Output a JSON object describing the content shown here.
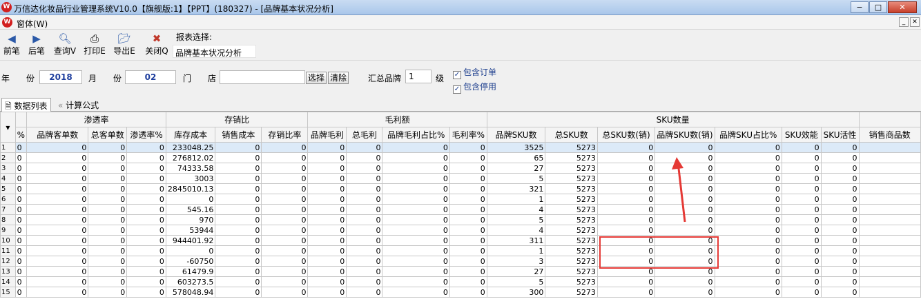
{
  "window": {
    "title": "万信达化妆品行业管理系统V10.0【旗舰版:1】【PPT】(180327) - [品牌基本状况分析]",
    "logo_text": "W"
  },
  "menu": {
    "item": "窗体(W)"
  },
  "toolbar": {
    "prev": "前笔",
    "next": "后笔",
    "query": "查询V",
    "print": "打印E",
    "export": "导出E",
    "close": "关闭Q",
    "report_select_label": "报表选择:",
    "report_value": "品牌基本状况分析"
  },
  "filter": {
    "year_label": "年　　份",
    "year_value": "2018",
    "month_label": "月　　份",
    "month_value": "02",
    "store_label": "门　　店",
    "store_value": "",
    "select_btn": "选择",
    "clear_btn": "清除",
    "brand_level_label": "汇总品牌",
    "brand_level_value": "1",
    "level_suffix": "级",
    "include_orders": "包含订单",
    "include_disabled": "包含停用"
  },
  "tabs": {
    "data_list": "数据列表",
    "formula": "计算公式"
  },
  "grid": {
    "groups": {
      "penetration": "渗透率",
      "stock_sales": "存销比",
      "gross_profit": "毛利额",
      "sku": "SKU数量"
    },
    "columns": [
      "%",
      "品牌客单数",
      "总客单数",
      "渗透率%",
      "库存成本",
      "销售成本",
      "存销比率",
      "品牌毛利",
      "总毛利",
      "品牌毛利占比%",
      "毛利率%",
      "品牌SKU数",
      "总SKU数",
      "总SKU数(销)",
      "品牌SKU数(销)",
      "品牌SKU占比%",
      "SKU效能",
      "SKU活性",
      "销售商品数"
    ],
    "rows": [
      {
        "n": "1",
        "stock": "233048.25",
        "sku": "3525",
        "total": "5273"
      },
      {
        "n": "2",
        "stock": "276812.02",
        "sku": "65",
        "total": "5273"
      },
      {
        "n": "3",
        "stock": "74333.58",
        "sku": "27",
        "total": "5273"
      },
      {
        "n": "4",
        "stock": "3003",
        "sku": "5",
        "total": "5273"
      },
      {
        "n": "5",
        "stock": "2845010.13",
        "sku": "321",
        "total": "5273"
      },
      {
        "n": "6",
        "stock": "0",
        "sku": "1",
        "total": "5273"
      },
      {
        "n": "7",
        "stock": "545.16",
        "sku": "4",
        "total": "5273"
      },
      {
        "n": "8",
        "stock": "970",
        "sku": "5",
        "total": "5273"
      },
      {
        "n": "9",
        "stock": "53944",
        "sku": "4",
        "total": "5273"
      },
      {
        "n": "10",
        "stock": "944401.92",
        "sku": "311",
        "total": "5273"
      },
      {
        "n": "11",
        "stock": "0",
        "sku": "1",
        "total": "5273"
      },
      {
        "n": "12",
        "stock": "-60750",
        "sku": "3",
        "total": "5273"
      },
      {
        "n": "13",
        "stock": "61479.9",
        "sku": "27",
        "total": "5273"
      },
      {
        "n": "14",
        "stock": "603273.5",
        "sku": "5",
        "total": "5273"
      },
      {
        "n": "15",
        "stock": "578048.94",
        "sku": "300",
        "total": "5273"
      }
    ],
    "zero": "0"
  }
}
